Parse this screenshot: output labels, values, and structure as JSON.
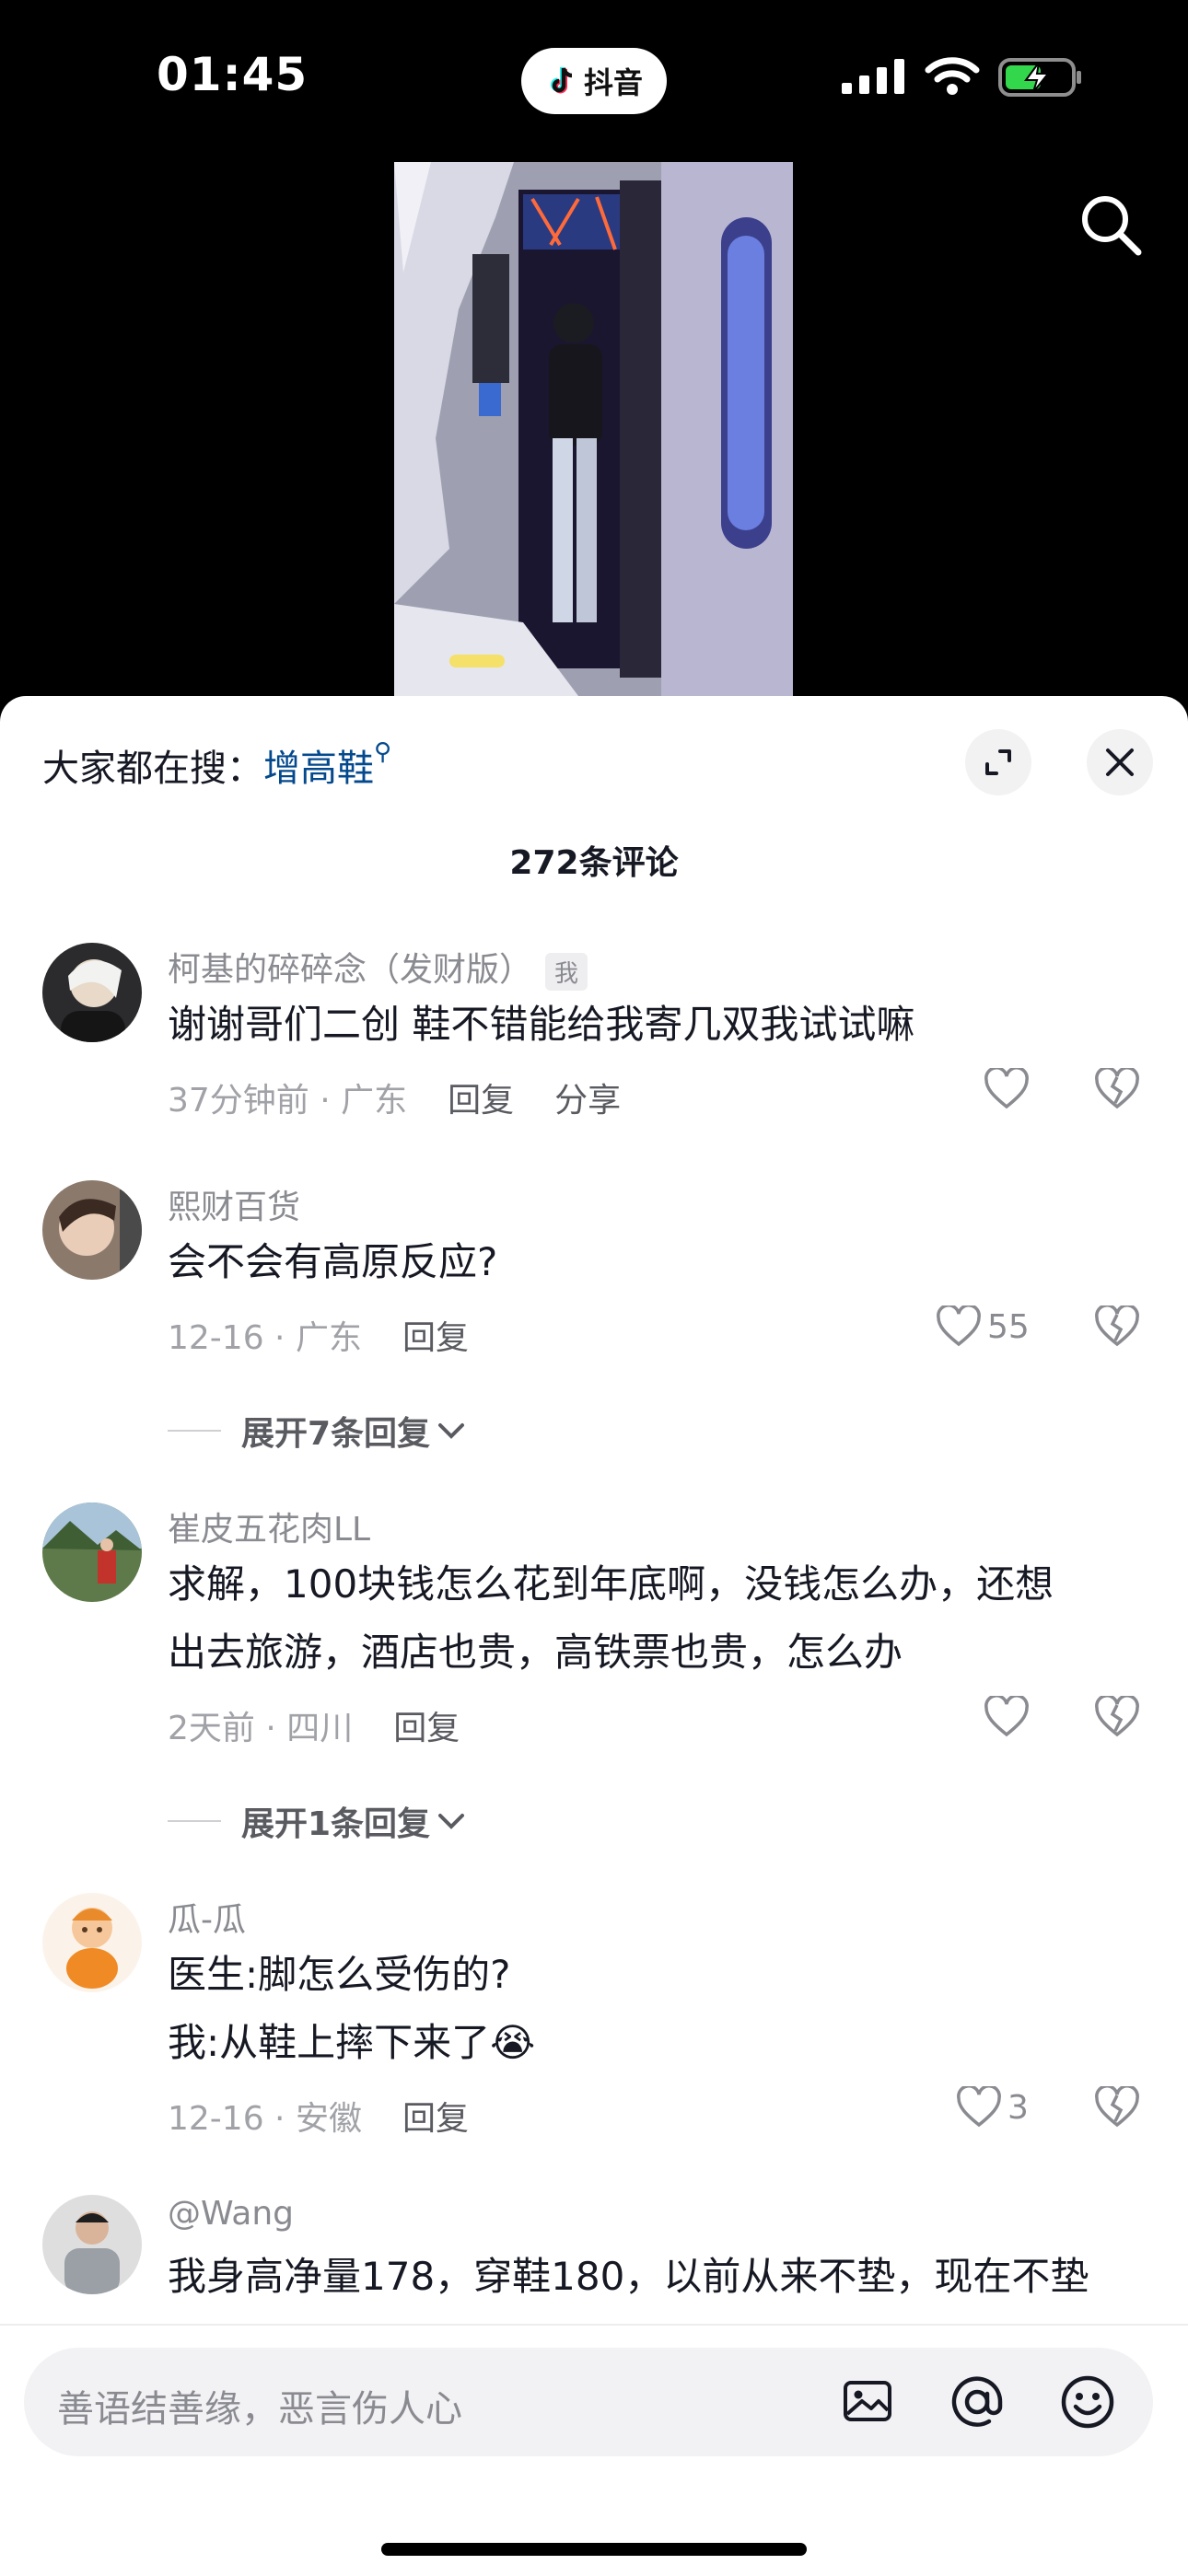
{
  "status_bar": {
    "time": "01:45",
    "app_pill_label": "抖音"
  },
  "sheet": {
    "suggest_prefix": "大家都在搜：",
    "suggest_keyword": "增高鞋",
    "comment_count": "272条评论",
    "comments": [
      {
        "username": "柯基的碎碎念（发财版）",
        "me_tag": "我",
        "lines": [
          "谢谢哥们二创 鞋不错能给我寄几双我试试嘛"
        ],
        "meta": "37分钟前 · 广东",
        "reply": "回复",
        "share": "分享",
        "likes": ""
      },
      {
        "username": "熙财百货",
        "lines": [
          "会不会有高原反应?"
        ],
        "meta": "12-16 · 广东",
        "reply": "回复",
        "likes": "55",
        "expand": "展开7条回复"
      },
      {
        "username": "崔皮五花肉LL",
        "lines": [
          "求解，100块钱怎么花到年底啊，没钱怎么办，还想",
          "出去旅游，酒店也贵，高铁票也贵，怎么办"
        ],
        "meta": "2天前 · 四川",
        "reply": "回复",
        "likes": "",
        "expand": "展开1条回复"
      },
      {
        "username": "瓜-瓜",
        "lines": [
          "医生:脚怎么受伤的?",
          "我:从鞋上摔下来了😭"
        ],
        "meta": "12-16 · 安徽",
        "reply": "回复",
        "likes": "3"
      },
      {
        "username": "@Wang",
        "lines": [
          "我身高净量178，穿鞋180，以前从来不垫，现在不垫"
        ]
      }
    ]
  },
  "input": {
    "placeholder": "善语结善缘，恶言伤人心"
  },
  "icons": [
    "search-icon",
    "expand-icon",
    "close-icon",
    "heart-icon",
    "dislike-icon",
    "chevron-down-icon",
    "image-icon",
    "at-icon",
    "emoji-icon"
  ]
}
